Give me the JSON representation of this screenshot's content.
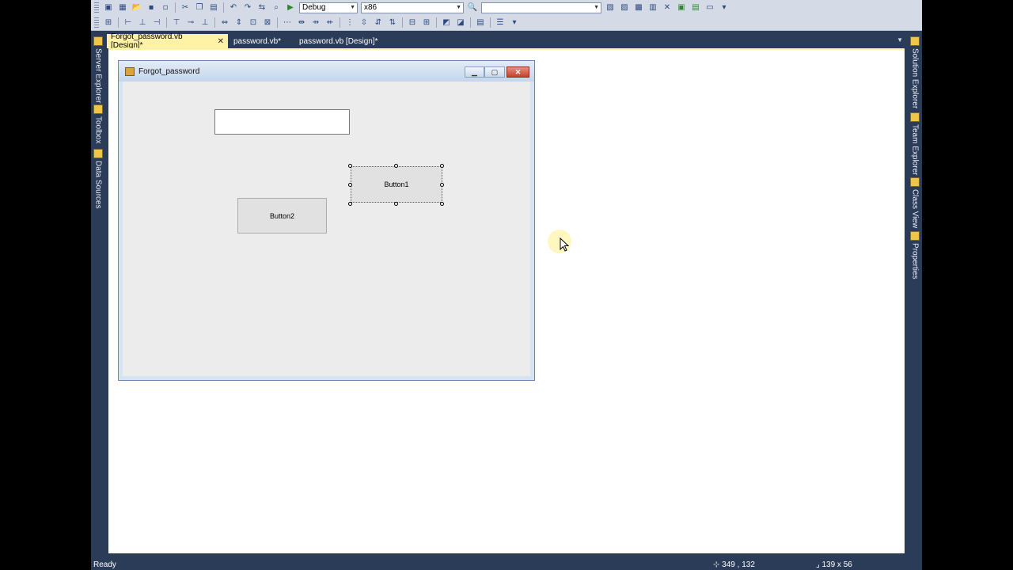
{
  "toolbar": {
    "configuration": "Debug",
    "platform": "x86",
    "search_value": ""
  },
  "tabs": [
    {
      "label": "Forgot_password.vb [Design]*",
      "active": true
    },
    {
      "label": "password.vb*",
      "active": false
    },
    {
      "label": "password.vb [Design]*",
      "active": false
    }
  ],
  "left_rail": [
    "Server Explorer",
    "Toolbox",
    "Data Sources"
  ],
  "right_rail": [
    "Solution Explorer",
    "Team Explorer",
    "Class View",
    "Properties"
  ],
  "form": {
    "title": "Forgot_password",
    "textbox_value": "",
    "button1_label": "Button1",
    "button2_label": "Button2"
  },
  "status": {
    "text": "Ready",
    "position": "349 , 132",
    "size": "139 x 56"
  },
  "colors": {
    "ide_background": "#2b3c59",
    "active_tab": "#fdf2a5",
    "form_client": "#ececec"
  }
}
